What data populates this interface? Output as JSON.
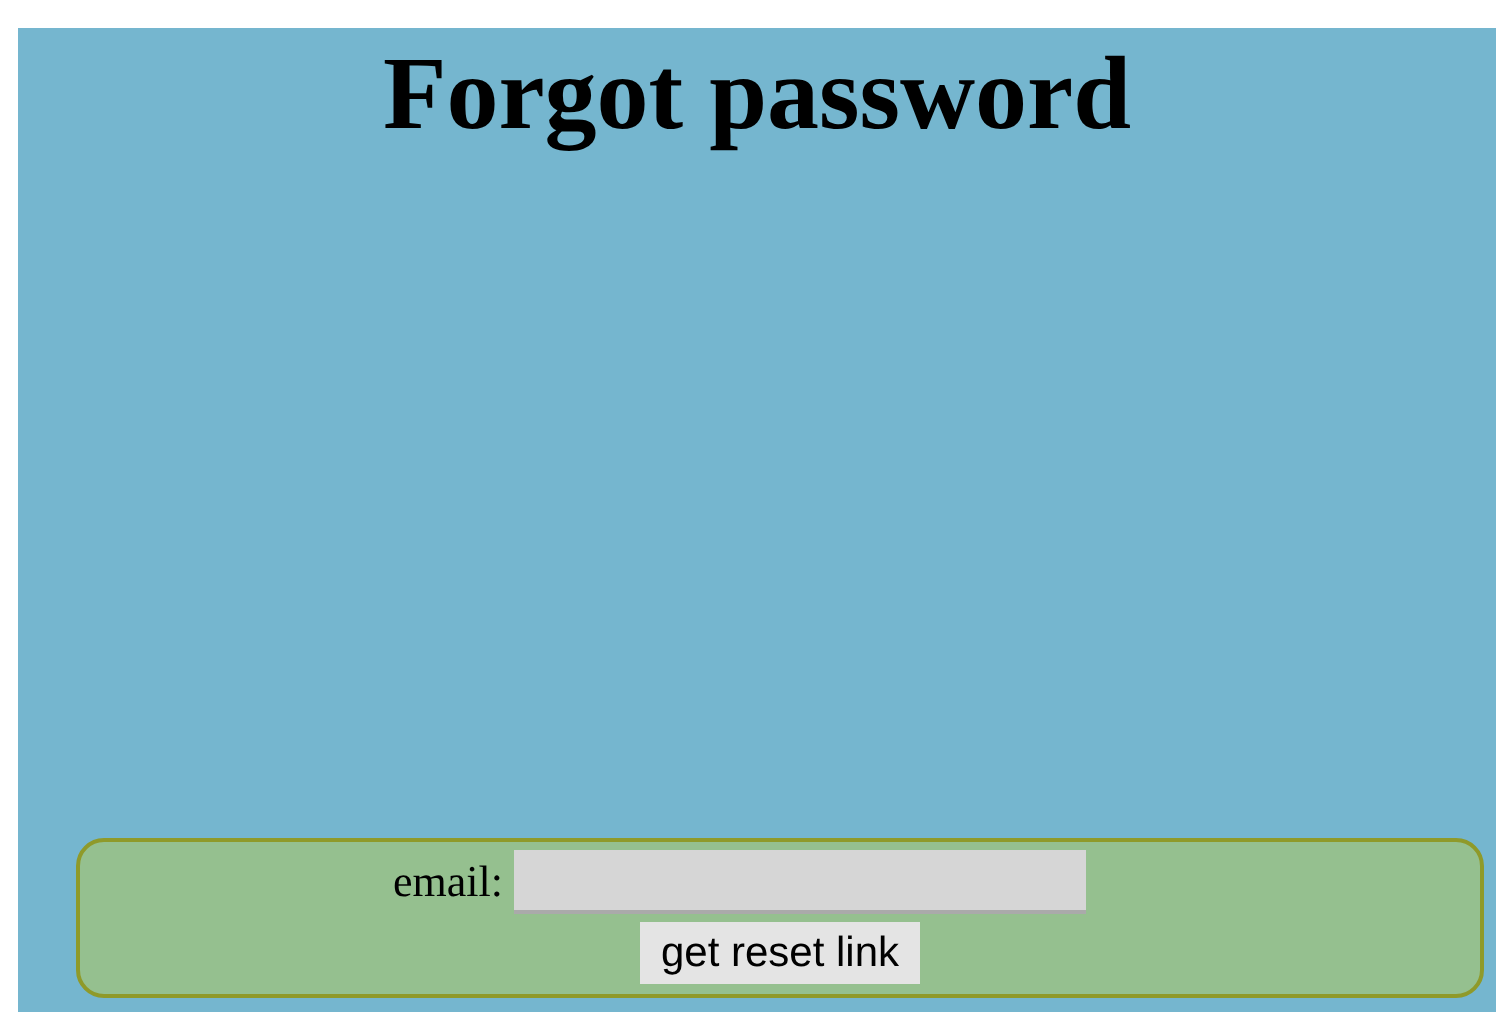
{
  "title": "Forgot password",
  "form": {
    "email_label": "email:",
    "button": "get reset link"
  }
}
